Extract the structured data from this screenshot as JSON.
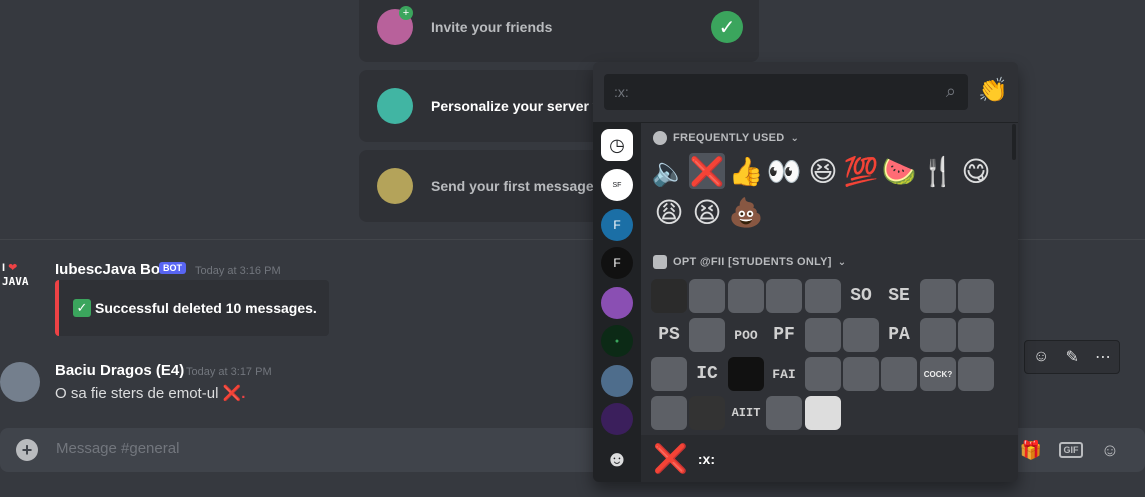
{
  "onboarding": {
    "invite": "Invite your friends",
    "personalize": "Personalize your server with",
    "first_message": "Send your first message",
    "invite_done": "✓"
  },
  "messages": [
    {
      "author": "IubescJava Bot",
      "badge": "BOT",
      "timestamp": "Today at 3:16 PM",
      "embed_text": "Successful deleted 10 messages.",
      "avatar_label": "I ❤ JAVA"
    },
    {
      "author": "Baciu Dragos (E4)",
      "timestamp": "Today at 3:17 PM",
      "content": "O sa fie sters de emot-ul",
      "content_emoji": "❌."
    }
  ],
  "hover_actions": [
    "add-reaction",
    "edit",
    "more"
  ],
  "composer": {
    "placeholder": "Message #general",
    "gif_label": "GIF"
  },
  "emoji_picker": {
    "search_value": ":x:",
    "diversity_emoji": "👏",
    "frequently_used_title": "FREQUENTLY USED",
    "server_section_title": "OPT @FII [STUDENTS ONLY]",
    "frequent": [
      "🔈",
      "❌",
      "👍",
      "👀",
      "😆",
      "💯",
      "🍉",
      "🍴",
      "😋",
      "😩",
      "😫",
      "💩"
    ],
    "custom": [
      "PS",
      "SO",
      "SE",
      "PS",
      "POO",
      "PF",
      "PA",
      "IC",
      "FAI",
      "COCK?",
      "AIIT"
    ],
    "preview_emoji": "❌",
    "preview_name": ":x:"
  },
  "rail": [
    "recent-clock-icon",
    "server-sf-icon",
    "server-fii-icon",
    "server-fii-2020-icon",
    "server-lol-icon",
    "server-green-icon",
    "server-shield-icon",
    "server-purple-icon",
    "smile-icon"
  ]
}
